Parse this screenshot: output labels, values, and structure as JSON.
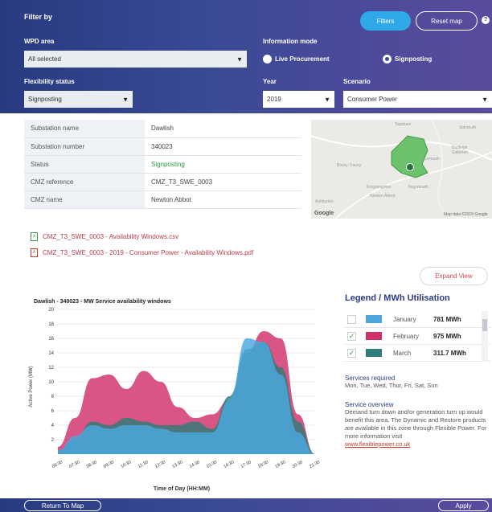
{
  "filter": {
    "title": "Filter by",
    "filters_btn": "Filters",
    "reset_btn": "Reset map",
    "help": "?",
    "wpd_area_label": "WPD area",
    "wpd_area_value": "All selected",
    "info_mode_label": "Information mode",
    "info_mode_options": [
      "Live Procurement",
      "Signposting"
    ],
    "flex_label": "Flexibility status",
    "flex_value": "Signposting",
    "year_label": "Year",
    "year_value": "2019",
    "scenario_label": "Scenario",
    "scenario_value": "Consumer Power"
  },
  "substation": {
    "rows": [
      {
        "key": "Substation name",
        "value": "Dawlish"
      },
      {
        "key": "Substation number",
        "value": "340023"
      },
      {
        "key": "Status",
        "value": "Signposting"
      },
      {
        "key": "CMZ reference",
        "value": "CMZ_T3_SWE_0003"
      },
      {
        "key": "CMZ name",
        "value": "Newton Abbot"
      }
    ]
  },
  "map": {
    "labels": [
      "Topsham",
      "Exmouth",
      "Budleigh Salterton",
      "Bovey Tracey",
      "Kingsteignton",
      "Teignmouth",
      "Newton Abbot",
      "Ashburton",
      "Sidmouth"
    ],
    "attribution": "Map data ©2019 Google",
    "google": "Google"
  },
  "files": [
    {
      "name": "CMZ_T3_SWE_0003 - Availability Windows.csv",
      "type": "csv"
    },
    {
      "name": "CMZ_T3_SWE_0003 - 2019 - Consumer Power - Availability Windows.pdf",
      "type": "pdf"
    }
  ],
  "expand_btn": "Expand View",
  "legend": {
    "title": "Legend / MWh Utilisation",
    "items": [
      {
        "month": "January",
        "value": "781 MWh",
        "checked": false,
        "color": "#4aa8de"
      },
      {
        "month": "February",
        "value": "975 MWh",
        "checked": true,
        "color": "#d0306a"
      },
      {
        "month": "March",
        "value": "311.7 MWh",
        "checked": true,
        "color": "#2f7d78"
      }
    ],
    "services_title": "Services required",
    "services_text": "Mon, Tue, Wed, Thur, Fri, Sat, Sun",
    "overview_title": "Service overview",
    "overview_text": "Demand turn down and/or generation turn up would benefit this area. The Dynamic and Restore products are available in this zone through Flexible Power. For more information visit",
    "overview_link": "www.flexiblepower.co.uk"
  },
  "footer": {
    "return_btn": "Return To Map",
    "apply_btn": "Apply"
  },
  "chart_data": {
    "type": "area",
    "title": "Dawlish - 340023 - MW Service availability windows",
    "xlabel": "Time of Day (HH:MM)",
    "ylabel": "Active Power (MW)",
    "ylim": [
      0,
      20
    ],
    "yticks": [
      2,
      4,
      6,
      8,
      10,
      12,
      14,
      16,
      18,
      20
    ],
    "categories": [
      "06:30",
      "07:30",
      "08:30",
      "09:30",
      "10:30",
      "11:30",
      "12:30",
      "13:30",
      "14:30",
      "15:30",
      "16:30",
      "17:30",
      "18:30",
      "19:30",
      "20:30",
      "21:30"
    ],
    "series": [
      {
        "name": "February",
        "color": "#d0306a",
        "values": [
          1,
          5,
          10.5,
          11,
          9,
          11.5,
          10,
          6.5,
          5,
          5.5,
          7.5,
          14,
          17,
          16,
          5.5,
          0
        ]
      },
      {
        "name": "March",
        "color": "#2f7d78",
        "values": [
          0.5,
          2,
          4.5,
          4,
          5,
          4.5,
          4,
          4,
          4.5,
          3.5,
          8,
          14.5,
          15.5,
          12,
          4.5,
          0
        ]
      },
      {
        "name": "January",
        "color": "#4aa8de",
        "values": [
          0.5,
          2.5,
          4,
          3.5,
          4,
          4,
          3.5,
          3,
          3,
          3,
          7.5,
          16,
          15.5,
          11,
          3,
          0
        ]
      }
    ]
  }
}
